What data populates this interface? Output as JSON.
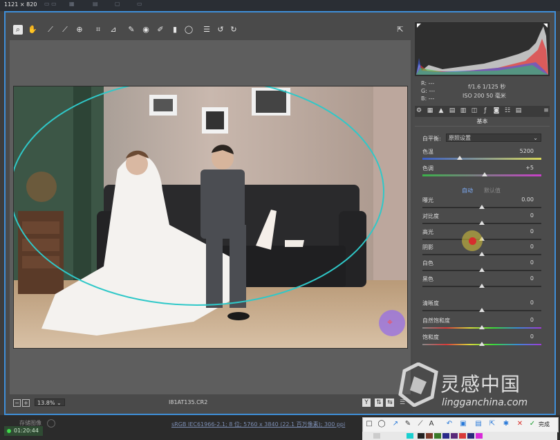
{
  "topstrip": {
    "dimensions": "1121 × 820",
    "ghost_tabs": [
      "",
      "",
      ""
    ]
  },
  "tools": [
    "zoom",
    "hand",
    "white-balance",
    "color-sampler",
    "targeted-adjust",
    "crop",
    "straighten",
    "spot-removal",
    "red-eye",
    "adjustment-brush",
    "graduated-filter",
    "radial-filter",
    "presets-list",
    "rotate-ccw",
    "rotate-cw",
    "open-prefs"
  ],
  "bottom": {
    "zoom": "13.8%",
    "filename": "I81AT135.CR2"
  },
  "info": {
    "r": "R:  ---",
    "g": "G:  ---",
    "b": "B:  ---",
    "exposure": "f/1.6   1/125 秒",
    "iso": "ISO 200   50 毫米"
  },
  "panel": {
    "section_title": "基本",
    "wb_label": "白平衡:",
    "wb_value": "原照设置",
    "temp_label": "色温",
    "temp_value": "5200",
    "tint_label": "色调",
    "tint_value": "+5",
    "auto_label": "自动",
    "default_label": "默认值",
    "sliders": [
      {
        "label": "曝光",
        "value": "0.00",
        "pos": 0.5
      },
      {
        "label": "对比度",
        "value": "0",
        "pos": 0.5
      },
      {
        "label": "高光",
        "value": "0",
        "pos": 0.5
      },
      {
        "label": "阴影",
        "value": "0",
        "pos": 0.5
      },
      {
        "label": "白色",
        "value": "0",
        "pos": 0.5
      },
      {
        "label": "黑色",
        "value": "0",
        "pos": 0.5
      },
      {
        "label": "清晰度",
        "value": "0",
        "pos": 0.5
      },
      {
        "label": "自然饱和度",
        "value": "0",
        "pos": 0.5
      },
      {
        "label": "饱和度",
        "value": "0",
        "pos": 0.5
      }
    ]
  },
  "footer": {
    "time": "01:20:44",
    "save_label": "存储图像",
    "file_info": "sRGB IEC61966-2.1; 8 位; 5760 x 3840 (22.1 百万像素); 300 ppi",
    "done_label": "完成"
  },
  "watermark": {
    "cn": "灵感中国",
    "url": "lingganchina.com"
  },
  "colors": {
    "accent": "#3f8fd9",
    "panel": "#4b4b4b",
    "ellipse": "#2fc8c8"
  }
}
